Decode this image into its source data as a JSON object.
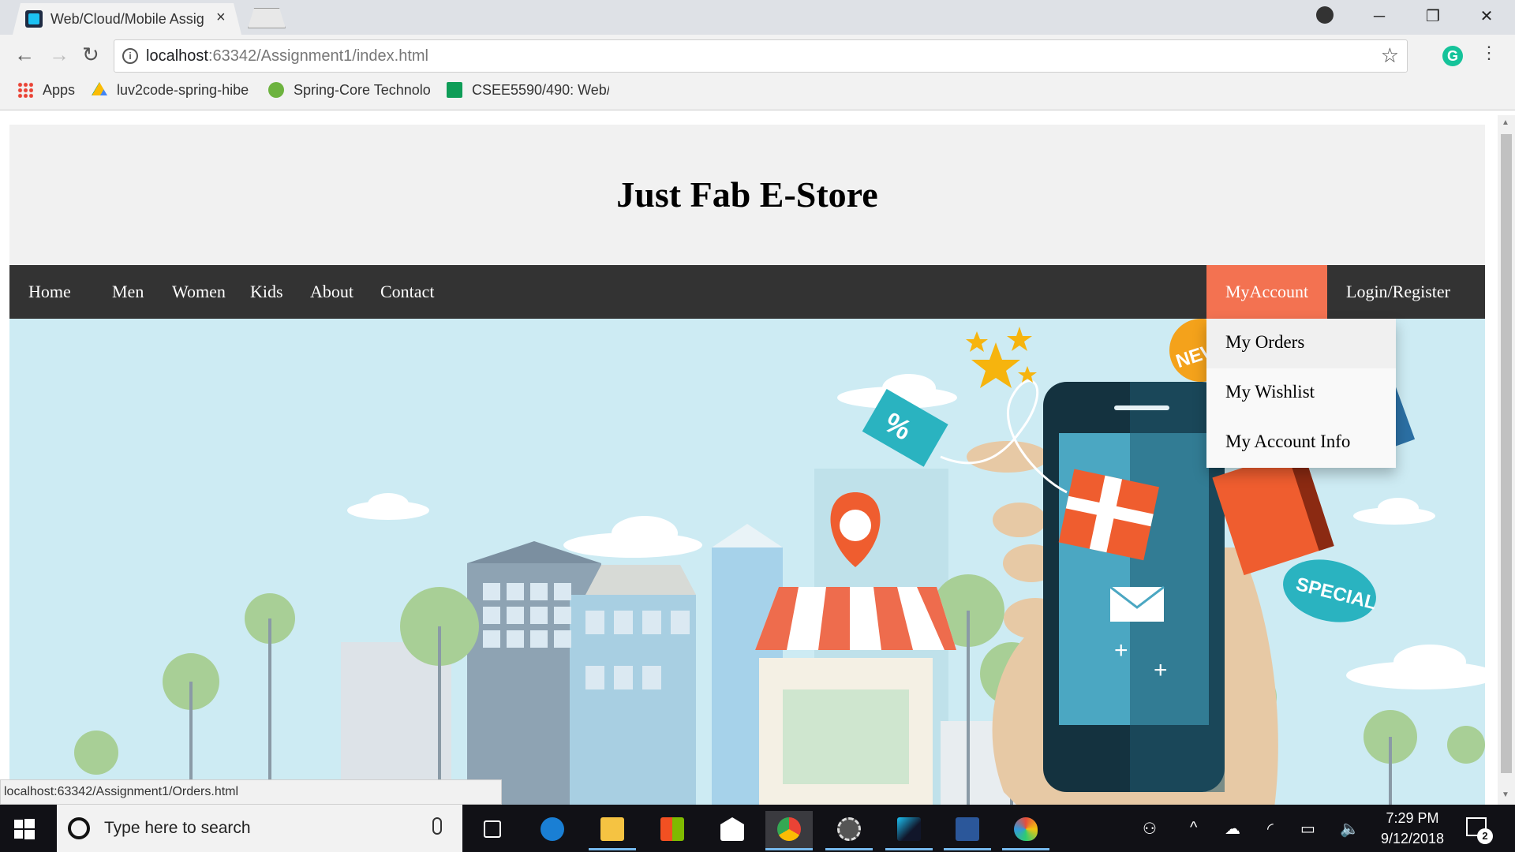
{
  "browser": {
    "tab_title": "Web/Cloud/Mobile Assig",
    "tab_close": "×",
    "url_host": "localhost",
    "url_path": ":63342/Assignment1/index.html",
    "bookmarks": [
      {
        "label": "Apps"
      },
      {
        "label": "luv2code-spring-hibe"
      },
      {
        "label": "Spring-Core Technolo"
      },
      {
        "label": "CSEE5590/490: Web/("
      }
    ],
    "status_url": "localhost:63342/Assignment1/Orders.html",
    "grammarly_letter": "G"
  },
  "site": {
    "title": "Just Fab E-Store",
    "nav": [
      {
        "label": "Home"
      },
      {
        "label": "Men"
      },
      {
        "label": "Women"
      },
      {
        "label": "Kids"
      },
      {
        "label": "About"
      },
      {
        "label": "Contact"
      }
    ],
    "nav_right": [
      {
        "label": "MyAccount",
        "active": true
      },
      {
        "label": "Login/Register"
      }
    ],
    "dropdown": [
      {
        "label": "My Orders"
      },
      {
        "label": "My Wishlist"
      },
      {
        "label": "My Account Info"
      }
    ],
    "accent": "#f37251",
    "hero_text": {
      "tag_new": "NEW",
      "tag_special": "SPECIAL",
      "tag_percent": "%"
    }
  },
  "taskbar": {
    "search_placeholder": "Type here to search",
    "time": "7:29 PM",
    "date": "9/12/2018",
    "notification_count": "2"
  }
}
